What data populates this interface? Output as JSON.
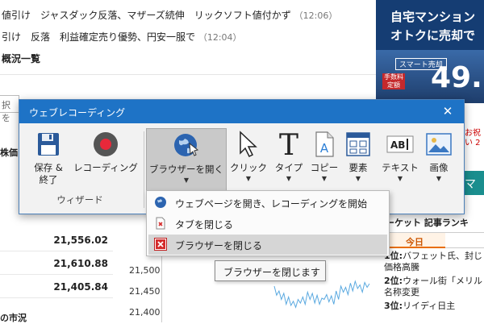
{
  "news": {
    "line1": "値引け　ジャスダック反落、マザーズ続伸　リックソフト値付かず",
    "line1_time": "（12:06）",
    "line2": "引け　反落　利益確定売り優勢、円安一服で",
    "line2_time": "（12:04）",
    "heading": "概況一覧",
    "search_fragment": "択を",
    "tab_fragment": "株価",
    "index_values": [
      "21,556.02",
      "21,610.88",
      "21,405.84"
    ],
    "market_fragment": "の市況",
    "chart_labels": [
      "21,500",
      "21,450",
      "21,400"
    ]
  },
  "chart_data": {
    "type": "line",
    "x": [
      0,
      1,
      2,
      3,
      4,
      5,
      6,
      7,
      8,
      9,
      10,
      11,
      12,
      13,
      14,
      15,
      16,
      17,
      18,
      19,
      20,
      21,
      22,
      23,
      24,
      25,
      26,
      27,
      28,
      29,
      30,
      31,
      32,
      33,
      34,
      35,
      36,
      37,
      38,
      39,
      40
    ],
    "series": [
      {
        "name": "",
        "values": [
          21440,
          21425,
          21432,
          21418,
          21428,
          21410,
          21422,
          21408,
          21415,
          21405,
          21418,
          21412,
          21422,
          21410,
          21430,
          21418,
          21428,
          21412,
          21425,
          21410,
          21420,
          21418,
          21426,
          21414,
          21424,
          21410,
          21432,
          21418,
          21440,
          21430,
          21438,
          21426,
          21445,
          21432,
          21448,
          21436,
          21442,
          21430,
          21446,
          21438,
          21444
        ]
      }
    ],
    "ylim": [
      21380,
      21540
    ],
    "color": "#5aa9e0"
  },
  "ad": {
    "title1": "自宅マンション",
    "title2": "オトクに売却で",
    "badge": "スマート売却",
    "tags": "手数料 定額",
    "number": "49.",
    "side_text": "お祝い 2"
  },
  "ranking": {
    "title": "ーケット 記事ランキ",
    "tab_today": "今日",
    "items": [
      {
        "rank": "1位:",
        "text": "バフェット氏、封じ 価格高騰"
      },
      {
        "rank": "2位:",
        "text": "ウォール街「メリル 名称変更"
      },
      {
        "rank": "3位:",
        "text": "リイディ日主"
      }
    ]
  },
  "dialog": {
    "title": "ウェブレコーディング",
    "close": "✕",
    "buttons": {
      "save_end": "保存 &\n終了",
      "recording": "レコーディング",
      "open_browser": "ブラウザーを開く",
      "click": "クリック",
      "type": "タイプ",
      "copy": "コピー",
      "element": "要素",
      "text": "テキスト",
      "image": "画像"
    },
    "group_label": "ウィザード"
  },
  "menu": {
    "items": [
      "ウェブページを開き、レコーディングを開始",
      "タブを閉じる",
      "ブラウザーを閉じる"
    ],
    "tooltip": "ブラウザーを閉じます"
  },
  "colors": {
    "titlebar": "#1e73c6",
    "record_red": "#e8283a",
    "close_red": "#d42c2c"
  }
}
